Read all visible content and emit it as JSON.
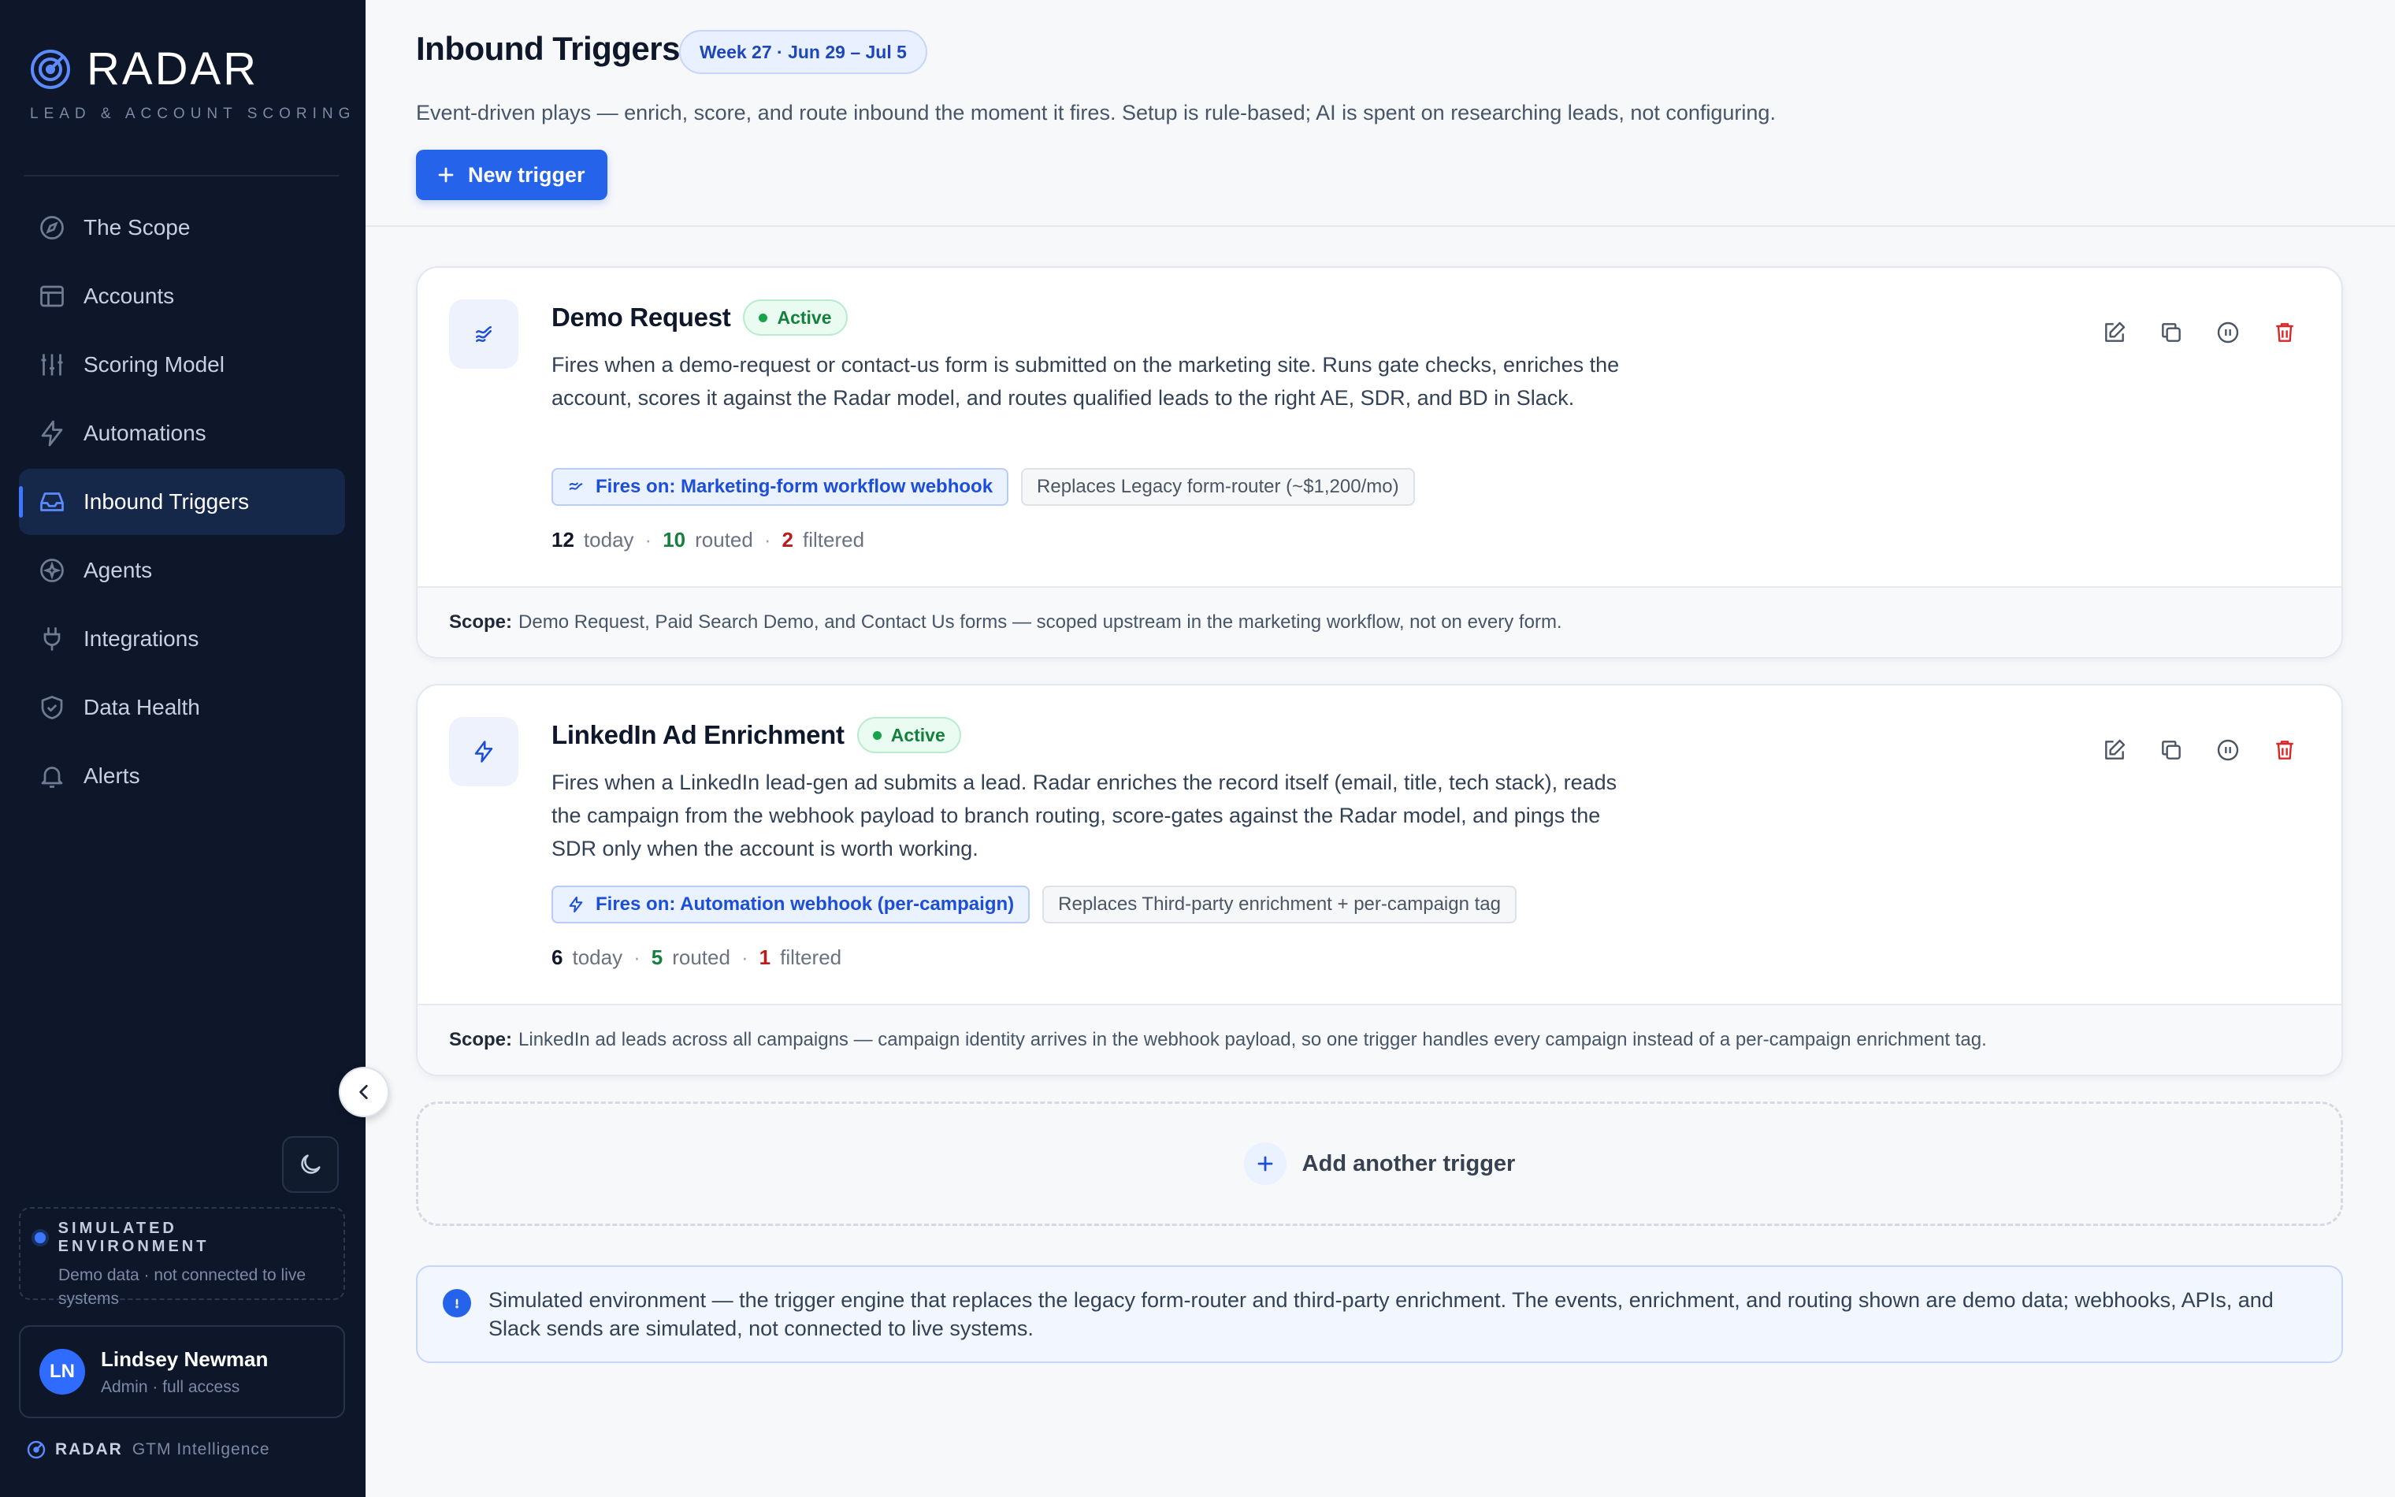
{
  "brand": {
    "name": "RADAR",
    "tagline": "LEAD & ACCOUNT SCORING"
  },
  "nav": [
    {
      "label": "The Scope",
      "icon": "compass-icon"
    },
    {
      "label": "Accounts",
      "icon": "table-icon"
    },
    {
      "label": "Scoring Model",
      "icon": "sliders-icon"
    },
    {
      "label": "Automations",
      "icon": "bolt-icon"
    },
    {
      "label": "Inbound Triggers",
      "icon": "inbox-icon",
      "active": true
    },
    {
      "label": "Agents",
      "icon": "sparkle-icon"
    },
    {
      "label": "Integrations",
      "icon": "plug-icon"
    },
    {
      "label": "Data Health",
      "icon": "shield-icon"
    },
    {
      "label": "Alerts",
      "icon": "bell-icon"
    }
  ],
  "sim_env": {
    "title": "SIMULATED ENVIRONMENT",
    "desc": "Demo data · not connected to live systems"
  },
  "user": {
    "initials": "LN",
    "name": "Lindsey Newman",
    "role": "Admin · full access"
  },
  "footer": {
    "name": "RADAR",
    "sub": "GTM Intelligence"
  },
  "header": {
    "title": "Inbound Triggers",
    "week_badge": "Week 27 · Jun 29 – Jul 5",
    "description": "Event-driven plays — enrich, score, and route inbound the moment it fires. Setup is rule-based; AI is spent on researching leads, not configuring.",
    "new_button": "New trigger"
  },
  "triggers": [
    {
      "title": "Demo Request",
      "status": "Active",
      "icon": "webhook-icon",
      "description": "Fires when a demo-request or contact-us form is submitted on the marketing site. Runs gate checks, enriches the account, scores it against the Radar model, and routes qualified leads to the right AE, SDR, and BD in Slack.",
      "fires_on": "Fires on: Marketing-form workflow webhook",
      "replaces": "Replaces Legacy form-router (~$1,200/mo)",
      "stats": {
        "today": "12",
        "today_label": "today",
        "routed": "10",
        "routed_label": "routed",
        "filtered": "2",
        "filtered_label": "filtered"
      },
      "scope_label": "Scope:",
      "scope": "Demo Request, Paid Search Demo, and Contact Us forms — scoped upstream in the marketing workflow, not on every form."
    },
    {
      "title": "LinkedIn Ad Enrichment",
      "status": "Active",
      "icon": "bolt-icon",
      "description": "Fires when a LinkedIn lead-gen ad submits a lead. Radar enriches the record itself (email, title, tech stack), reads the campaign from the webhook payload to branch routing, score-gates against the Radar model, and pings the SDR only when the account is worth working.",
      "fires_on": "Fires on: Automation webhook (per-campaign)",
      "replaces": "Replaces Third-party enrichment + per-campaign tag",
      "stats": {
        "today": "6",
        "today_label": "today",
        "routed": "5",
        "routed_label": "routed",
        "filtered": "1",
        "filtered_label": "filtered"
      },
      "scope_label": "Scope:",
      "scope": "LinkedIn ad leads across all campaigns — campaign identity arrives in the webhook payload, so one trigger handles every campaign instead of a per-campaign enrichment tag."
    }
  ],
  "add_trigger": "Add another trigger",
  "notice": "Simulated environment — the trigger engine that replaces the legacy form-router and third-party enrichment. The events, enrichment, and routing shown are demo data; webhooks, APIs, and Slack sends are simulated, not connected to live systems.",
  "colors": {
    "accent": "#2563eb",
    "sidebar_bg": "#0e1729",
    "active_green": "#15803d",
    "filtered_red": "#b91c1c"
  }
}
